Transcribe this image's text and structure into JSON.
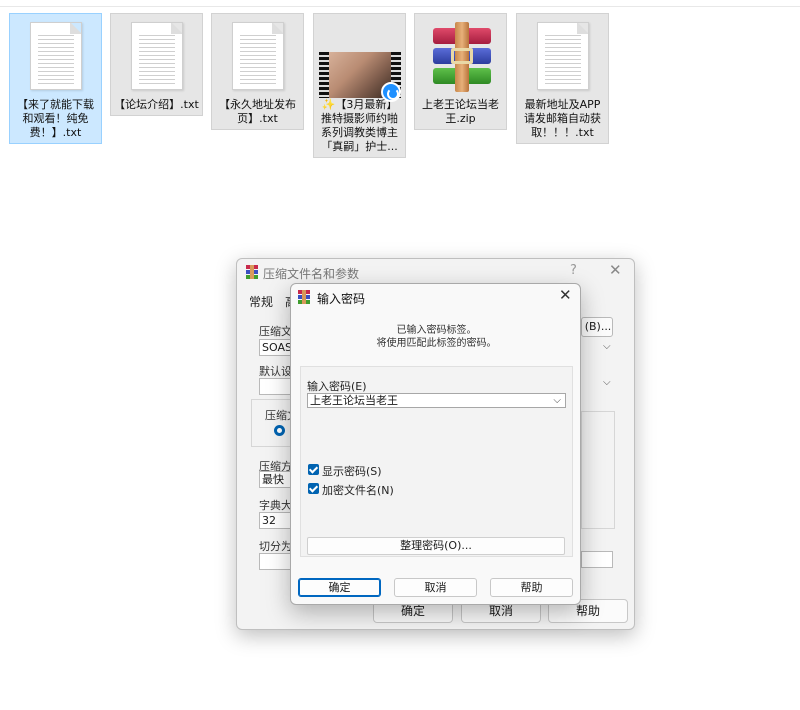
{
  "files": [
    {
      "name": "【来了就能下载和观看！纯免费！】.txt",
      "type": "txt",
      "selected": true
    },
    {
      "name": "【论坛介绍】.txt",
      "type": "txt",
      "selected": false
    },
    {
      "name": "【永久地址发布页】.txt",
      "type": "txt",
      "selected": false
    },
    {
      "name": "✨【3月最新】推特摄影师约啪系列调教类博主「真嗣」护士...",
      "type": "video",
      "selected": false
    },
    {
      "name": "上老王论坛当老王.zip",
      "type": "zip",
      "selected": false
    },
    {
      "name": "最新地址及APP请发邮箱自动获取！！！.txt",
      "type": "txt",
      "selected": false
    }
  ],
  "archive_dialog": {
    "title": "压缩文件名和参数",
    "help": "?",
    "close": "✕",
    "tabs": [
      "常规",
      "高"
    ],
    "archive_name_label": "压缩文",
    "archive_name_value": "SOASM",
    "browse_label": "(B)...",
    "default_profile_label": "默认设",
    "format_group_label": "压缩文",
    "method_label": "压缩方",
    "method_value": "最快",
    "dict_label": "字典大",
    "dict_value": "32",
    "split_label": "切分为",
    "ok_label": "确定",
    "cancel_label": "取消",
    "help_label": "帮助"
  },
  "password_dialog": {
    "title": "输入密码",
    "close": "✕",
    "message_line1": "已输入密码标签。",
    "message_line2": "将使用匹配此标签的密码。",
    "password_label": "输入密码(E)",
    "password_value": "上老王论坛当老王",
    "show_password_label": "显示密码(S)",
    "show_password_checked": true,
    "encrypt_names_label": "加密文件名(N)",
    "encrypt_names_checked": true,
    "organize_label": "整理密码(O)...",
    "ok_label": "确定",
    "cancel_label": "取消",
    "help_label": "帮助"
  }
}
